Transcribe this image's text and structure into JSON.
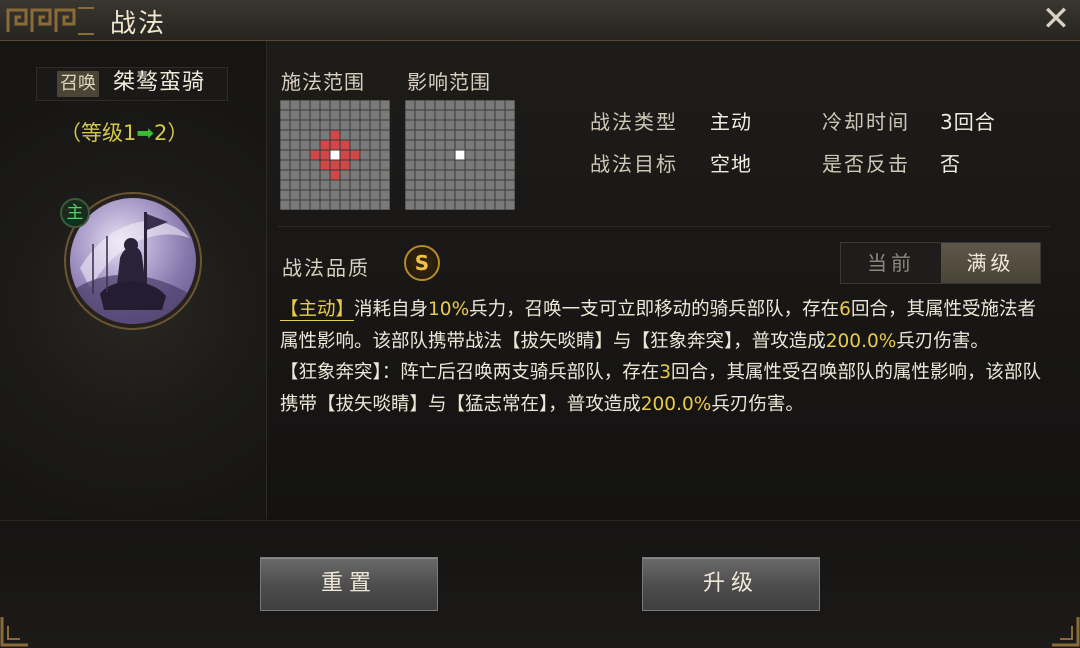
{
  "window": {
    "title": "战法",
    "close_icon": "close-icon"
  },
  "skill": {
    "summon_tag": "召唤",
    "name": "桀骜蛮骑",
    "level_prefix": "（等级1",
    "level_suffix": "2）",
    "main_badge": "主"
  },
  "ranges": {
    "cast_label": "施法范围",
    "effect_label": "影响范围"
  },
  "attributes": {
    "type_label": "战法类型",
    "type_value": "主动",
    "cooldown_label": "冷却时间",
    "cooldown_value": "3回合",
    "target_label": "战法目标",
    "target_value": "空地",
    "counter_label": "是否反击",
    "counter_value": "否"
  },
  "quality": {
    "label": "战法品质",
    "grade": "S"
  },
  "toggle": {
    "current": "当前",
    "max": "满级",
    "selected": "满级"
  },
  "description": {
    "p1_tag": "【主动】",
    "p1_a": "消耗自身",
    "p1_pct": "10%",
    "p1_b": "兵力，召唤一支可立即移动的骑兵部队，存在",
    "p1_turns": "6",
    "p1_c": "回合，其属性受施法者属性影响。该部队携带战法【拔矢啖睛】与【狂象奔突】，普攻造成",
    "p1_dmg": "200.0%",
    "p1_d": "兵刃伤害。",
    "p2_a": "【狂象奔突】：阵亡后召唤两支骑兵部队，存在",
    "p2_turns": "3",
    "p2_b": "回合，其属性受召唤部队的属性影响，该部队携带【拔矢啖睛】与【猛志常在】，普攻造成",
    "p2_dmg": "200.0%",
    "p2_c": "兵刃伤害。"
  },
  "buttons": {
    "reset": "重置",
    "upgrade": "升级"
  },
  "colors": {
    "highlight": "#e8cb4a",
    "range_red": "#d04848",
    "grid_cell": "#7a7a7a",
    "accent_green": "#3cbb34"
  }
}
